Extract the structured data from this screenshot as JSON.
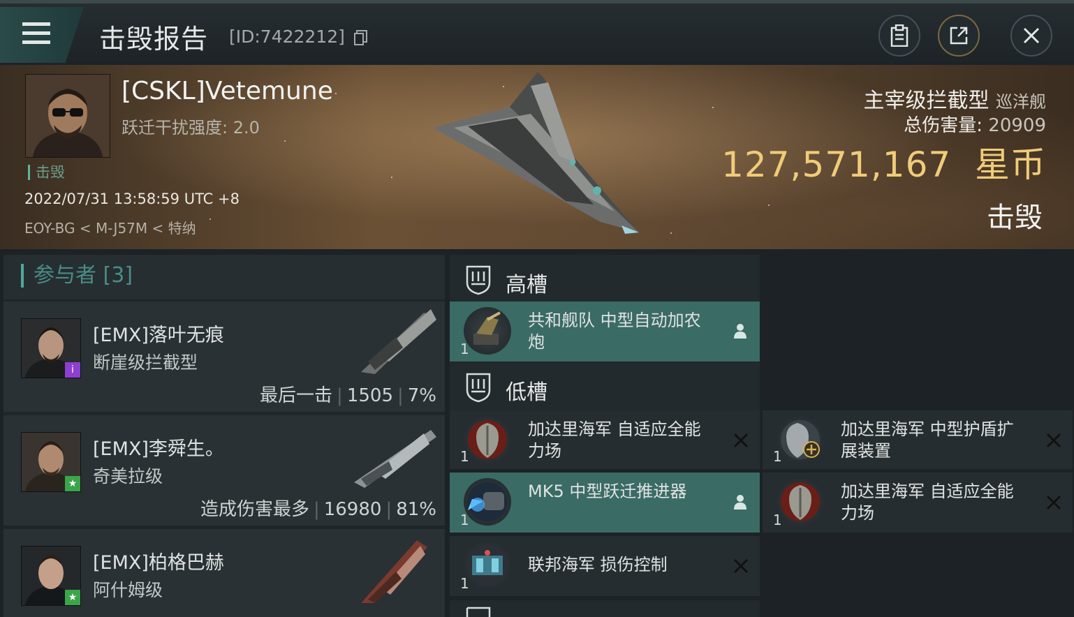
{
  "header": {
    "title": "击毁报告",
    "kill_id": "[ID:7422212]"
  },
  "victim": {
    "name": "[CSKL]Vetemune",
    "warp_label": "跃迁干扰强度: 2.0",
    "status_tag": "击毁",
    "datetime": "2022/07/31 13:58:59 UTC +8",
    "location": "EOY-BG < M-J57M < 特纳",
    "ship_type": "主宰级拦截型",
    "ship_class": "巡洋舰",
    "total_damage_label": "总伤害量:",
    "total_damage_value": "20909",
    "isk_value": "127,571,167",
    "isk_unit": "星币",
    "result": "击毁"
  },
  "participants": {
    "header": "参与者 [3]",
    "items": [
      {
        "name": "[EMX]落叶无痕",
        "ship": "断崖级拦截型",
        "tag": "最后一击",
        "damage": "1505",
        "percent": "7%",
        "badge_color": "#8e3fd0",
        "badge_icon": "info-icon"
      },
      {
        "name": "[EMX]李舜生。",
        "ship": "奇美拉级",
        "tag": "造成伤害最多",
        "damage": "16980",
        "percent": "81%",
        "badge_color": "#3ba54a",
        "badge_icon": "star-icon"
      },
      {
        "name": "[EMX]柏格巴赫",
        "ship": "阿什姆级",
        "tag": "",
        "damage": "",
        "percent": "",
        "badge_color": "#3ba54a",
        "badge_icon": "star-icon"
      }
    ]
  },
  "fitting": {
    "high_slot_label": "高槽",
    "low_slot_label": "低槽",
    "high": [
      {
        "name": "共和舰队 中型自动加农炮",
        "qty": "1",
        "state": "dropped"
      }
    ],
    "low": [
      {
        "name": "加达里海军 自适应全能力场",
        "qty": "1",
        "state": "destroyed"
      },
      {
        "name": "加达里海军 中型护盾扩展装置",
        "qty": "1",
        "state": "destroyed"
      },
      {
        "name": "MK5 中型跃迁推进器",
        "qty": "1",
        "state": "dropped"
      },
      {
        "name": "加达里海军 自适应全能力场",
        "qty": "1",
        "state": "destroyed"
      },
      {
        "name": "联邦海军 损伤控制",
        "qty": "1",
        "state": "destroyed"
      }
    ]
  },
  "colors": {
    "accent": "#4fa89d",
    "dropped_bg": "#3a6b65",
    "isk": "#f0cc7a"
  }
}
